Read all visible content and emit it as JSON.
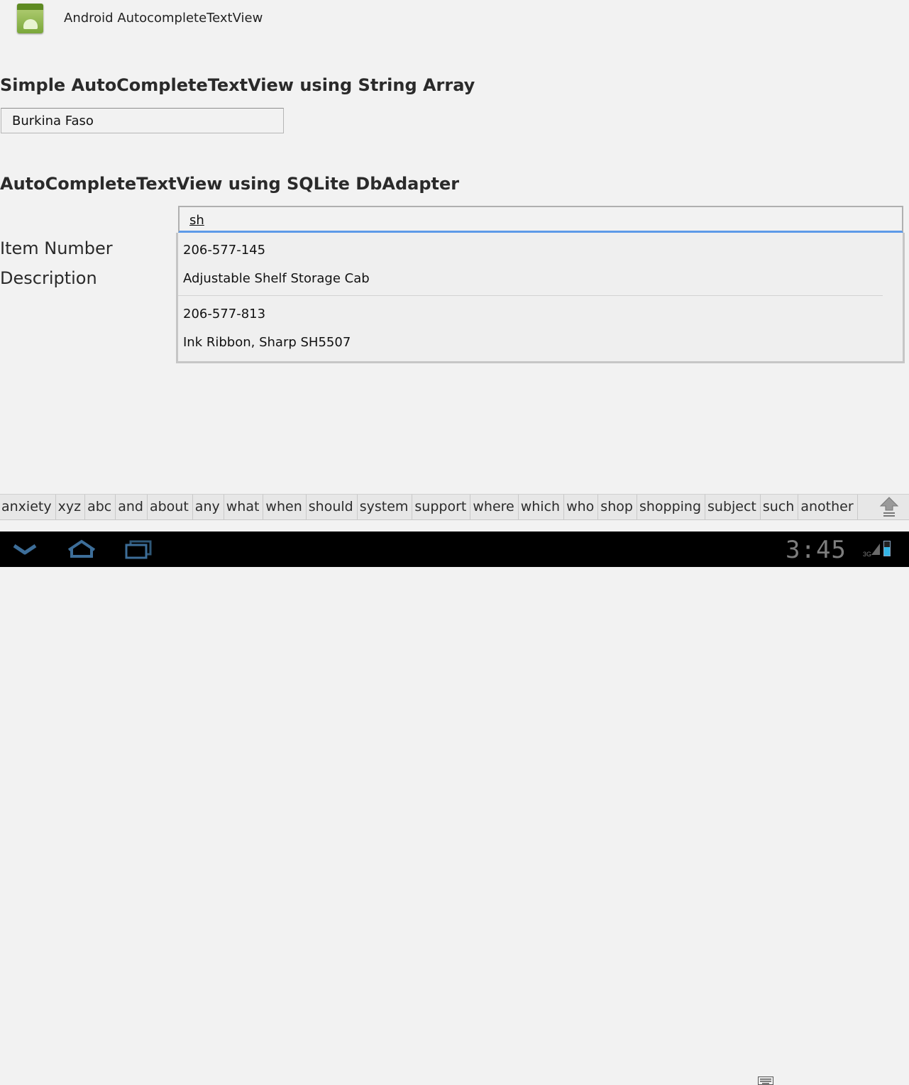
{
  "app": {
    "title": "Android AutocompleteTextView"
  },
  "section1": {
    "heading": "Simple AutoCompleteTextView using String Array",
    "input_value": "Burkina Faso"
  },
  "section2": {
    "heading": "AutoCompleteTextView using SQLite DbAdapter",
    "input_value": "sh",
    "labels": {
      "item_number": "Item Number",
      "description": "Description"
    },
    "suggestions": [
      {
        "number": "206-577-145",
        "description": "Adjustable Shelf Storage Cab"
      },
      {
        "number": "206-577-813",
        "description": "Ink Ribbon, Sharp SH5507"
      }
    ]
  },
  "keyboard_suggestions": [
    "anxiety",
    "xyz",
    "abc",
    "and",
    "about",
    "any",
    "what",
    "when",
    "should",
    "system",
    "support",
    "where",
    "which",
    "who",
    "shop",
    "shopping",
    "subject",
    "such",
    "another"
  ],
  "status": {
    "time": "3:45",
    "network": "3G"
  },
  "colors": {
    "background": "#f2f2f2",
    "focus_underline": "#5d9ae8",
    "navbar": "#000000"
  },
  "icons": [
    "android-app-icon",
    "shift-icon",
    "back-icon",
    "home-icon",
    "recent-apps-icon",
    "keyboard-icon",
    "signal-icon",
    "battery-icon"
  ]
}
